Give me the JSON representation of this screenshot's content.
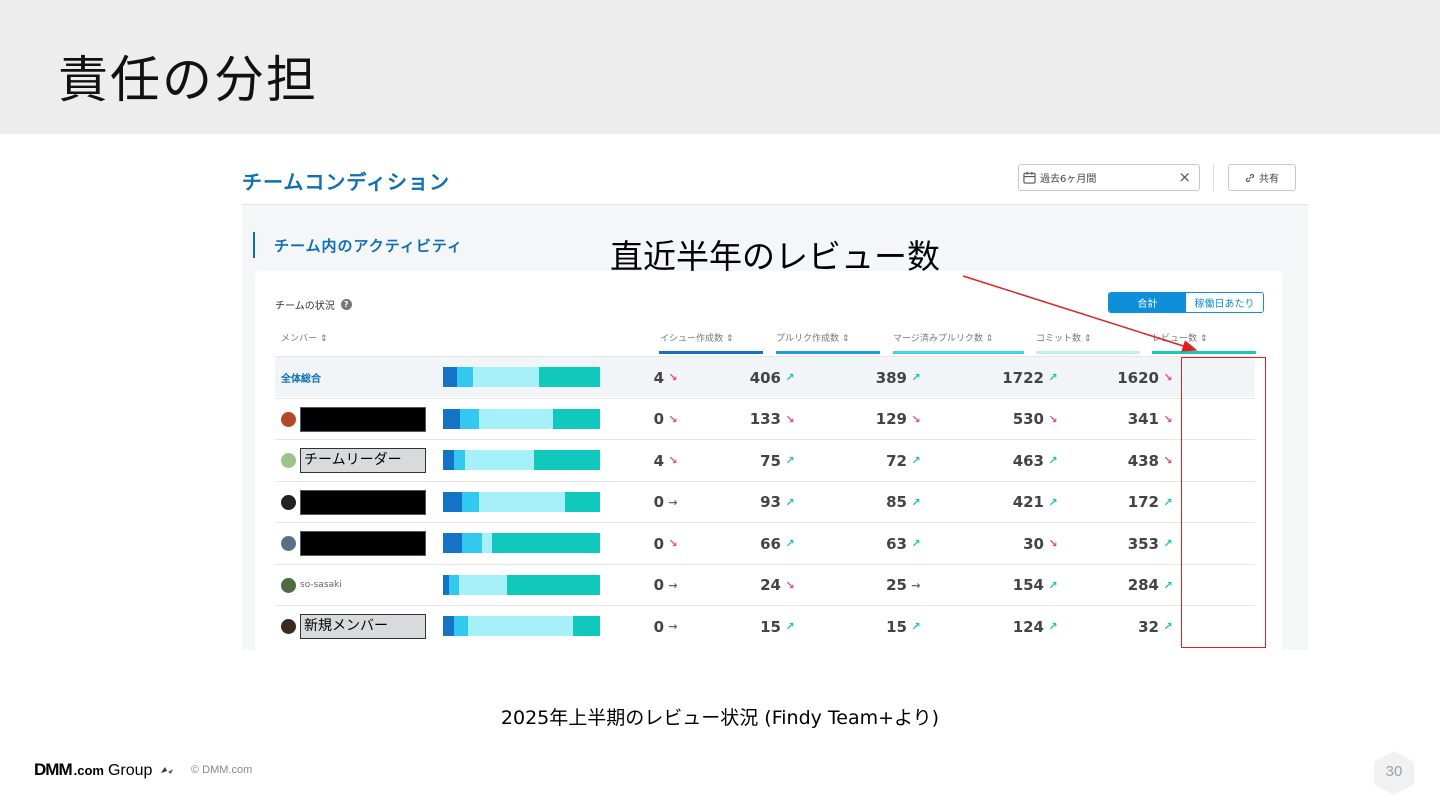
{
  "slide": {
    "title": "責任の分担",
    "caption": "2025年上半期のレビュー状況 (Findy Team+より)",
    "annotation": "直近半年のレビュー数",
    "page_number": "30",
    "copyright": "© DMM.com",
    "logo": {
      "dmm": "DMM",
      "com": ".com",
      "group": "Group"
    }
  },
  "app": {
    "title": "チームコンディション",
    "date_filter": "過去6ヶ月間",
    "clear_icon": "×",
    "share_label": "共有",
    "section_title": "チーム内のアクティビティ",
    "card_label": "チームの状況",
    "help_icon": "?",
    "toggle": {
      "total": "合計",
      "per_day": "稼働日あたり"
    },
    "columns": {
      "member": "メンバー ⇕",
      "issues": "イシュー作成数 ⇕",
      "prs": "プルリク作成数 ⇕",
      "merged": "マージ済みプルリク数 ⇕",
      "commits": "コミット数 ⇕",
      "reviews": "レビュー数 ⇕"
    },
    "column_colors": {
      "issues": "#1473c4",
      "prs": "#1aa0e0",
      "merged": "#3fd2e8",
      "commits": "#bdeff7",
      "reviews": "#18c8b8"
    },
    "rows": [
      {
        "name": "全体総合",
        "kind": "total",
        "bar": [
          0.09,
          0.1,
          0.42,
          0.39
        ],
        "issues": "4",
        "issues_t": "↘",
        "prs": "406",
        "prs_t": "↗",
        "merged": "389",
        "merged_t": "↗",
        "commits": "1722",
        "commits_t": "↗",
        "reviews": "1620",
        "reviews_t": "↘"
      },
      {
        "name": "",
        "kind": "redacted",
        "avatar": "#b5482a",
        "bar": [
          0.11,
          0.12,
          0.47,
          0.3
        ],
        "issues": "0",
        "issues_t": "↘",
        "prs": "133",
        "prs_t": "↘",
        "merged": "129",
        "merged_t": "↘",
        "commits": "530",
        "commits_t": "↘",
        "reviews": "341",
        "reviews_t": "↘"
      },
      {
        "name": "チームリーダー",
        "kind": "label",
        "avatar": "#9cc48a",
        "bar": [
          0.07,
          0.07,
          0.44,
          0.42
        ],
        "issues": "4",
        "issues_t": "↘",
        "prs": "75",
        "prs_t": "↗",
        "merged": "72",
        "merged_t": "↗",
        "commits": "463",
        "commits_t": "↗",
        "reviews": "438",
        "reviews_t": "↘"
      },
      {
        "name": "",
        "kind": "redacted",
        "avatar": "#222222",
        "bar": [
          0.12,
          0.11,
          0.55,
          0.22
        ],
        "issues": "0",
        "issues_t": "→",
        "prs": "93",
        "prs_t": "↗",
        "merged": "85",
        "merged_t": "↗",
        "commits": "421",
        "commits_t": "↗",
        "reviews": "172",
        "reviews_t": "↗"
      },
      {
        "name": "",
        "kind": "redacted",
        "avatar": "#5a6f8a",
        "bar": [
          0.12,
          0.13,
          0.06,
          0.69
        ],
        "issues": "0",
        "issues_t": "↘",
        "prs": "66",
        "prs_t": "↗",
        "merged": "63",
        "merged_t": "↗",
        "commits": "30",
        "commits_t": "↘",
        "reviews": "353",
        "reviews_t": "↗"
      },
      {
        "name": "so-sasaki",
        "kind": "plain",
        "avatar": "#4f6b45",
        "bar": [
          0.04,
          0.06,
          0.31,
          0.59
        ],
        "issues": "0",
        "issues_t": "→",
        "prs": "24",
        "prs_t": "↘",
        "merged": "25",
        "merged_t": "→",
        "commits": "154",
        "commits_t": "↗",
        "reviews": "284",
        "reviews_t": "↗"
      },
      {
        "name": "新規メンバー",
        "kind": "label",
        "avatar": "#3a2a20",
        "bar": [
          0.07,
          0.09,
          0.67,
          0.17
        ],
        "issues": "0",
        "issues_t": "→",
        "prs": "15",
        "prs_t": "↗",
        "merged": "15",
        "merged_t": "↗",
        "commits": "124",
        "commits_t": "↗",
        "reviews": "32",
        "reviews_t": "↗"
      }
    ]
  }
}
